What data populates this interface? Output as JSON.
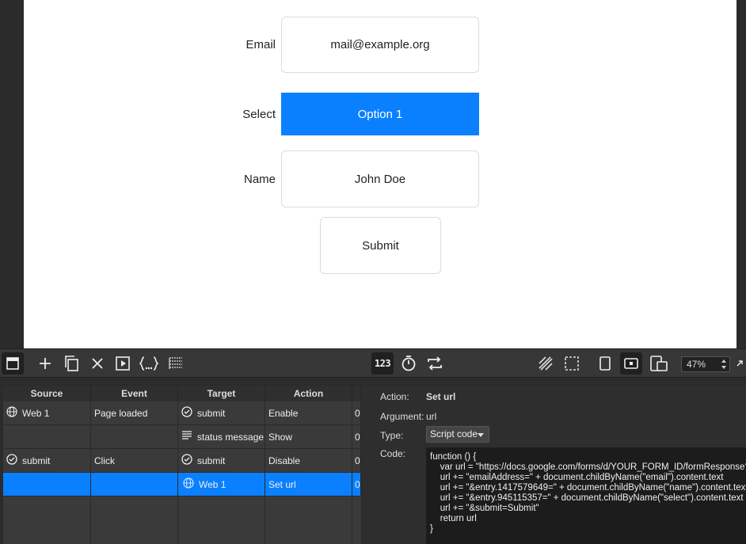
{
  "form": {
    "email_label": "Email",
    "email_value": "mail@example.org",
    "select_label": "Select",
    "select_value": "Option 1",
    "name_label": "Name",
    "name_value": "John Doe",
    "submit_label": "Submit",
    "select_color": "#0a80ff"
  },
  "toolbar": {
    "icons": [
      "panel-icon",
      "add-icon",
      "duplicate-icon",
      "delete-icon",
      "preview-icon",
      "script-icon",
      "list-icon",
      "number-icon",
      "timer-icon",
      "loop-icon",
      "hatch-icon",
      "selection-icon",
      "portrait-icon",
      "landscape-icon",
      "devices-icon",
      "expand-icon"
    ],
    "number_label": "123",
    "zoom": "47%"
  },
  "table": {
    "headers": [
      "Source",
      "Event",
      "Target",
      "Action",
      ""
    ],
    "rows": [
      {
        "source": "Web 1",
        "source_icon": "globe-icon",
        "event": "Page loaded",
        "target": "submit",
        "target_icon": "check-circle-icon",
        "action": "Enable",
        "extra": "0"
      },
      {
        "source": "",
        "source_icon": "",
        "event": "",
        "target": "status message",
        "target_icon": "text-lines-icon",
        "action": "Show",
        "extra": "0"
      },
      {
        "source": "submit",
        "source_icon": "check-circle-icon",
        "event": "Click",
        "target": "submit",
        "target_icon": "check-circle-icon",
        "action": "Disable",
        "extra": "0"
      },
      {
        "source": "",
        "source_icon": "",
        "event": "",
        "target": "Web 1",
        "target_icon": "globe-icon",
        "action": "Set url",
        "extra": "0"
      }
    ]
  },
  "props": {
    "action_label": "Action:",
    "action_value": "Set url",
    "argument_label": "Argument:",
    "argument_value": "url",
    "type_label": "Type:",
    "type_value": "Script code",
    "code_label": "Code:",
    "code": "function () {\n    var url = \"https://docs.google.com/forms/d/YOUR_FORM_ID/formResponse?\"\n    url += \"emailAddress=\" + document.childByName(\"email\").content.text\n    url += \"&entry.1417579649=\" + document.childByName(\"name\").content.text\n    url += \"&entry.945115357=\" + document.childByName(\"select\").content.text\n    url += \"&submit=Submit\"\n    return url\n}"
  }
}
